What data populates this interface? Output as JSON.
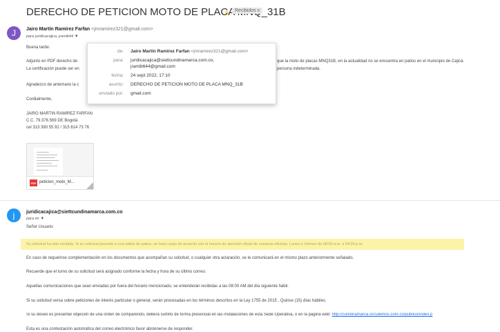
{
  "subject": "DERECHO DE PETICION MOTO DE PLACA MNQ_31B",
  "importance_marker": "»",
  "label_chip": "Recibidos x",
  "message1": {
    "avatar_letter": "J",
    "sender_name": "Jairo Martín Ramírez Farfan",
    "sender_email": "<jmramirez321@gmail.com>",
    "to_line": "para juridicacajica, jramib44",
    "greeting": "Buena tarde:",
    "para1_a": "Adjunto en PDF derecho de",
    "para1_b": "que la moto de placas MNQ31B, en la actualidad no se encuentra en patios en el municipio de Cajicá.",
    "para2_a": "La certificación puede ser en",
    "para2_b": "persona indeterminada.",
    "thanks": "Agradezco de antemano la c",
    "closing": "Cordialmente,",
    "sig_name": "JAIRO MARTIN RAMIREZ FARFAN",
    "sig_cc": "C.C. 79.376.569 DE Bogotá",
    "sig_phone": "cel 313 390 55 92  /  315 614 73 76"
  },
  "popup": {
    "rows": [
      {
        "key": "de:",
        "value": "Jairo Martín Ramírez Farfan",
        "extra": "<jmramirez321@gmail.com>"
      },
      {
        "key": "para:",
        "value": "juridicacajica@siettcundinamarca.com.co,",
        "value2": "jramib644@gmail.com"
      },
      {
        "key": "fecha:",
        "value": "24 sept 2022, 17:10"
      },
      {
        "key": "asunto:",
        "value": "DERECHO DE PETICION MOTO DE PLACA MNQ_31B"
      },
      {
        "key": "enviado por:",
        "value": "gmail.com"
      }
    ]
  },
  "attachment": {
    "type_label": "PDF",
    "filename": "peticion_moto_M..."
  },
  "message2": {
    "avatar_letter": "j",
    "sender": "juridicacajica@siettcundinamarca.com.co",
    "to_line": "para mí",
    "salutation": "Señor Usuario:",
    "highlight_text": "Su solicitud ha sido recibida.  Si su solicitud procede a una salida de patios, se hará cargo de acuerdo con el horario de atención oficial de nuestras oficinas.  Lunes a Viernes de 08:00 a.m. a 04:00 p.m.",
    "p1": "En caso de requerirse complementación en los documentos que acompañan su solicitud, o cualquier otra aclaración, se le comunicará en el mismo plazo anteriormente señalado.",
    "p2": "Recuerde que el turno de su solicitud será asignado conforme la fecha y hora de su último correo.",
    "p3": "Aquellas comunicaciones que sean enviadas por fuera del horario mencionado, se entenderán recibidas a las 08:00 AM del día siguiente hábil.",
    "p4": "Si su solicitud versa sobre peticiones de interés particular o general, serán procesadas en los términos descritos en la Ley 1755 de 2015 , Quince (15) días hábiles.",
    "p5": "Si su deseo es presentar objeción de una orden de comparendo, deberá surtirlo de forma presencial en las instalaciones de esta Sede Operativa, o en la pagina web:",
    "p5_link": "http://cundinamarca.circulemos.com.co/publico/index.p",
    "p6": "Esta es una contestación automática del correo electrónico favor abstenerse de responder."
  }
}
